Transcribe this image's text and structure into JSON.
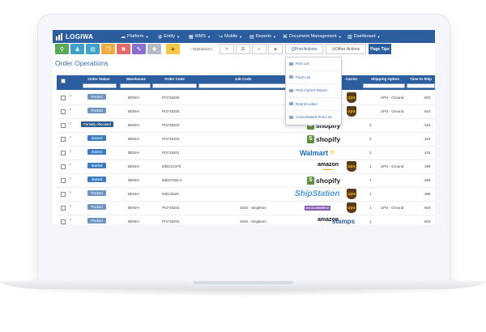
{
  "app": {
    "brand": "LOGIWA"
  },
  "nav": [
    {
      "label": "Platform",
      "icon": "cloud-icon"
    },
    {
      "label": "Entity",
      "icon": "globe-icon"
    },
    {
      "label": "WMS",
      "icon": "grid-icon"
    },
    {
      "label": "Mobile",
      "icon": "share-icon"
    },
    {
      "label": "Reports",
      "icon": "report-icon"
    },
    {
      "label": "Document Management",
      "icon": "document-icon"
    },
    {
      "label": "Dashboard",
      "icon": "bar-chart-icon"
    }
  ],
  "toolbar": {
    "buttons": [
      {
        "icon": "search-icon",
        "color": "#5aa85a",
        "glyph": "🔍"
      },
      {
        "icon": "user-icon",
        "color": "#3fa0c9",
        "glyph": "👤"
      },
      {
        "icon": "clipboard-icon",
        "color": "#3fa0c9",
        "glyph": "📋"
      },
      {
        "icon": "copy-icon",
        "color": "#f0ab3e",
        "glyph": "❐"
      },
      {
        "icon": "trash-icon",
        "color": "#e56b6b",
        "glyph": "🗑"
      },
      {
        "icon": "magic-wand-icon",
        "color": "#8b6fcf",
        "glyph": "✎"
      },
      {
        "icon": "move-icon",
        "color": "#b6bcc4",
        "glyph": "✚"
      },
      {
        "icon": "star-icon",
        "color": "#f5c844",
        "glyph": "★"
      }
    ],
    "operations_label": "Operations",
    "print_actions": "Print Actions",
    "other_actions": "Other Actions",
    "page_tips": "Page Tips"
  },
  "page_title": "Order Operations",
  "print_menu": [
    "Pick List",
    "Pack List",
    "Print Carrier Report",
    "Reprint Label",
    "Consolidated Pick List"
  ],
  "table": {
    "columns": [
      "Order Status",
      "Warehouse",
      "Order Code",
      "Job Code",
      "Channel",
      "Carrier",
      "Shipping Option",
      "Time to Ship"
    ],
    "rows": [
      {
        "status": "Packed",
        "warehouse": "BENIH",
        "order_code": "PCF25208",
        "job_code": "",
        "channel": "amazon",
        "qty": "",
        "carrier": "ups",
        "shipping": "UPS - Ground",
        "time": "603"
      },
      {
        "status": "Packed",
        "warehouse": "BENIH",
        "order_code": "PCF25205",
        "job_code": "",
        "channel": "shopify",
        "qty": "",
        "carrier": "ups",
        "shipping": "UPS - Ground",
        "time": "603"
      },
      {
        "status": "Partially Allocated",
        "warehouse": "BENIH",
        "order_code": "PCF25204",
        "job_code": "",
        "channel": "shopify",
        "qty": "2",
        "carrier": "",
        "shipping": "",
        "time": "434"
      },
      {
        "status": "Started",
        "warehouse": "BENIH",
        "order_code": "PCF25203",
        "job_code": "",
        "channel": "shopify",
        "qty": "2",
        "carrier": "",
        "shipping": "",
        "time": "422"
      },
      {
        "status": "Started",
        "warehouse": "BENIH",
        "order_code": "PCF25201",
        "job_code": "",
        "channel": "walmart",
        "qty": "2",
        "carrier": "",
        "shipping": "",
        "time": "432"
      },
      {
        "status": "Started",
        "warehouse": "BENIH",
        "order_code": "IMD121376",
        "job_code": "",
        "channel": "amazon",
        "qty": "1",
        "carrier": "ups",
        "shipping": "UPS - Ground",
        "time": "399"
      },
      {
        "status": "Started",
        "warehouse": "BENIH",
        "order_code": "IMD27926.2",
        "job_code": "",
        "channel": "shopify",
        "qty": "1",
        "carrier": "",
        "shipping": "",
        "time": "399"
      },
      {
        "status": "Packed",
        "warehouse": "BENIH",
        "order_code": "IMD22529",
        "job_code": "",
        "channel": "shipstation",
        "qty": "1",
        "carrier": "ups",
        "shipping": "",
        "time": "399"
      },
      {
        "status": "Packed",
        "warehouse": "BENIH",
        "order_code": "PCF25202",
        "job_code": "3346 - Singleton",
        "channel": "woocommerce",
        "qty": "1",
        "carrier": "ups",
        "shipping": "UPS - Ground",
        "time": "603"
      },
      {
        "status": "Packed",
        "warehouse": "BENIH",
        "order_code": "PCF25203",
        "job_code": "3346 - Singleton",
        "channel": "amazon",
        "qty": "1",
        "carrier": "stamps",
        "shipping": "",
        "time": "603"
      }
    ]
  },
  "logos": {
    "amazon": "amazon",
    "shopify": "shopify",
    "walmart": "Walmart",
    "shipstation": "ShipStation",
    "woocommerce": "WOOCOMMERCE",
    "ups": "ups",
    "stamps": "stamps"
  },
  "colors": {
    "nav": "#2c5d9f",
    "packed": "#6f93c2",
    "started": "#3b7bbf",
    "partial": "#2d5a8c",
    "amazon_arrow": "#f19a1a",
    "shopify": "#5e8e3e",
    "walmart": "#1a6fc1",
    "walmart_spark": "#ffc220",
    "shipstation": "#4a9bd4",
    "woo": "#7f54b3"
  }
}
